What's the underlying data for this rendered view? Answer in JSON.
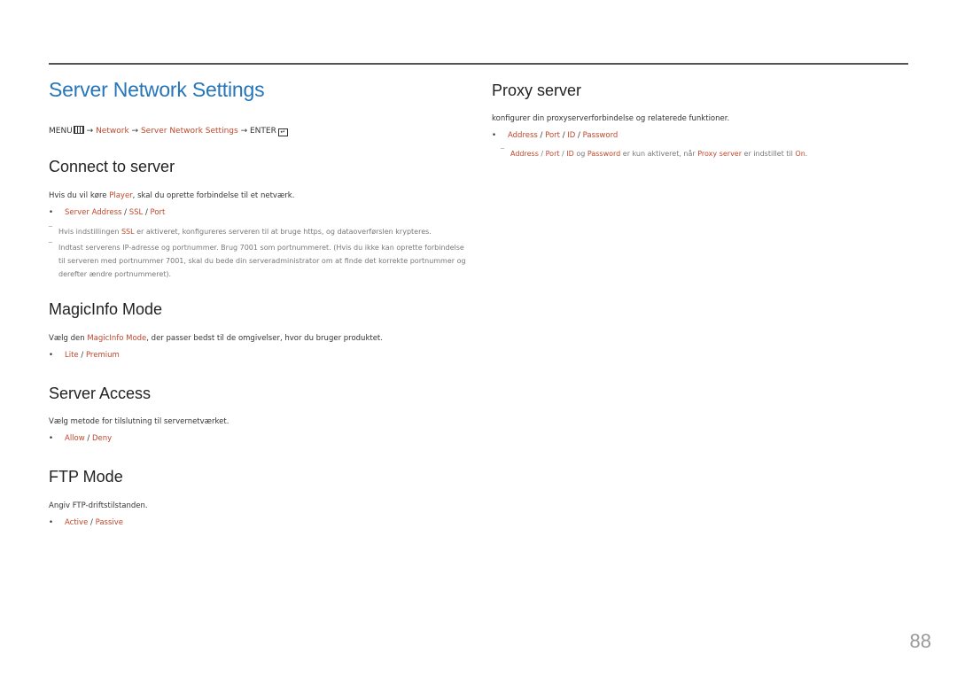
{
  "page_title": "Server Network Settings",
  "breadcrumb": {
    "menu": "MENU",
    "arrow": "→",
    "network": "Network",
    "server_network_settings": "Server Network Settings",
    "enter": "ENTER"
  },
  "sections": {
    "connect": {
      "title": "Connect to server",
      "desc_before": "Hvis du vil køre ",
      "desc_hl": "Player",
      "desc_after": ", skal du oprette forbindelse til et netværk.",
      "options": [
        "Server Address",
        "SSL",
        "Port"
      ],
      "separator": " / ",
      "note1_before": "Hvis indstillingen ",
      "note1_hl": "SSL",
      "note1_after": " er aktiveret, konfigureres serveren til at bruge https, og dataoverførslen krypteres.",
      "note2": "Indtast serverens IP-adresse og portnummer. Brug 7001 som portnummeret. (Hvis du ikke kan oprette forbindelse til serveren med portnummer 7001, skal du bede din serveradministrator om at finde det korrekte portnummer og derefter ændre portnummeret)."
    },
    "magicinfo": {
      "title": "MagicInfo Mode",
      "desc_before": "Vælg den ",
      "desc_hl": "MagicInfo Mode",
      "desc_after": ", der passer bedst til de omgivelser, hvor du bruger produktet.",
      "options": [
        "Lite",
        "Premium"
      ]
    },
    "access": {
      "title": "Server Access",
      "desc": "Vælg metode for tilslutning til servernetværket.",
      "options": [
        "Allow",
        "Deny"
      ]
    },
    "ftp": {
      "title": "FTP Mode",
      "desc": "Angiv FTP-driftstilstanden.",
      "options": [
        "Active",
        "Passive"
      ]
    },
    "proxy": {
      "title": "Proxy server",
      "desc": "konfigurer din proxyserverforbindelse og relaterede funktioner.",
      "options": [
        "Address",
        "Port",
        "ID",
        "Password"
      ],
      "note_and": " og ",
      "note_mid": " er kun aktiveret, når ",
      "note_hl": "Proxy server",
      "note_mid2": " er indstillet til ",
      "note_on": "On",
      "note_end": "."
    }
  },
  "page_number": "88",
  "colors": {
    "title": "#2575b8",
    "highlight": "#c0482d",
    "rule": "#555555"
  }
}
